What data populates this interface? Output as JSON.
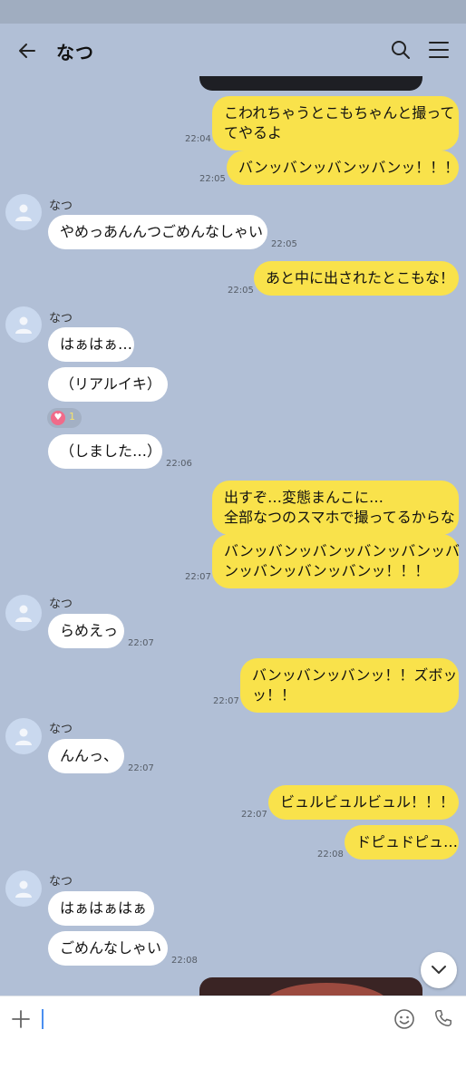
{
  "header": {
    "title": "なつ"
  },
  "messages": [
    {
      "side": "me",
      "lines": [
        "こわれちゃうとこもちゃんと撮って",
        "てやるよ"
      ],
      "time": "22:04"
    },
    {
      "side": "me",
      "lines": [
        "バンッバンッバンッバンッ！！！"
      ],
      "time": "22:05"
    },
    {
      "side": "other",
      "sender": "なつ",
      "lines": [
        "やめっあんんつごめんなしゃい"
      ],
      "time": "22:05"
    },
    {
      "side": "me",
      "lines": [
        "あと中に出されたとこもな！"
      ],
      "time": "22:05"
    },
    {
      "side": "other",
      "sender": "なつ",
      "lines": [
        "はぁはぁ…"
      ]
    },
    {
      "side": "other",
      "lines": [
        "（リアルイキ）"
      ],
      "reaction": {
        "icon": "heart-icon",
        "count": "1"
      }
    },
    {
      "side": "other",
      "lines": [
        "（しました…）"
      ],
      "time": "22:06"
    },
    {
      "side": "me",
      "lines": [
        "出すぞ…変態まんこに…",
        "全部なつのスマホで撮ってるからな"
      ]
    },
    {
      "side": "me",
      "lines": [
        "バンッバンッバンッバンッバンッバ",
        "ンッバンッバンッバンッ！！！"
      ],
      "time": "22:07"
    },
    {
      "side": "other",
      "sender": "なつ",
      "lines": [
        "らめえっ"
      ],
      "time": "22:07"
    },
    {
      "side": "me",
      "lines": [
        "バンッバンッバンッ！！ズボッ",
        "ッ！！"
      ],
      "time": "22:07"
    },
    {
      "side": "other",
      "sender": "なつ",
      "lines": [
        "んんっ、"
      ],
      "time": "22:07"
    },
    {
      "side": "me",
      "lines": [
        "ビュルビュルビュル！！！"
      ],
      "time": "22:07"
    },
    {
      "side": "me",
      "lines": [
        "ドピュドピュ…"
      ],
      "time": "22:08"
    },
    {
      "side": "other",
      "sender": "なつ",
      "lines": [
        "はぁはぁはぁ"
      ]
    },
    {
      "side": "other",
      "lines": [
        "ごめんなしゃい"
      ],
      "time": "22:08"
    }
  ],
  "colors": {
    "background": "#b1bfd6",
    "my_bubble": "#f9e24b",
    "other_bubble": "#ffffff"
  }
}
